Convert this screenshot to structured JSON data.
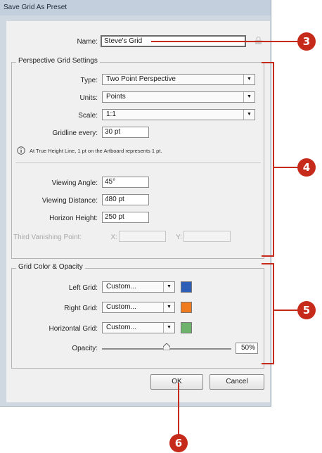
{
  "window": {
    "title": "Save Grid As Preset"
  },
  "name_field": {
    "label": "Name:",
    "value": "Steve's Grid"
  },
  "perspective_group": {
    "legend": "Perspective Grid Settings",
    "type": {
      "label": "Type:",
      "value": "Two Point Perspective"
    },
    "units": {
      "label": "Units:",
      "value": "Points"
    },
    "scale": {
      "label": "Scale:",
      "value": "1:1"
    },
    "gridline": {
      "label": "Gridline every:",
      "value": "30 pt"
    },
    "info_text": "At True Height Line, 1 pt on the Artboard represents 1 pt.",
    "viewing_angle": {
      "label": "Viewing Angle:",
      "value": "45°"
    },
    "viewing_distance": {
      "label": "Viewing Distance:",
      "value": "480 pt"
    },
    "horizon_height": {
      "label": "Horizon Height:",
      "value": "250 pt"
    },
    "third_vp": {
      "label": "Third Vanishing Point:",
      "x_label": "X:",
      "y_label": "Y:"
    }
  },
  "color_group": {
    "legend": "Grid Color & Opacity",
    "left": {
      "label": "Left Grid:",
      "value": "Custom...",
      "color": "#2d5fb8"
    },
    "right": {
      "label": "Right Grid:",
      "value": "Custom...",
      "color": "#f07a1e"
    },
    "horizontal": {
      "label": "Horizontal Grid:",
      "value": "Custom...",
      "color": "#6db36b"
    },
    "opacity": {
      "label": "Opacity:",
      "value": "50%",
      "fraction": 0.5
    }
  },
  "buttons": {
    "ok": "OK",
    "cancel": "Cancel"
  },
  "callouts": {
    "c3": "3",
    "c4": "4",
    "c5": "5",
    "c6": "6"
  },
  "colors": {
    "callout_red": "#c62a1a"
  }
}
